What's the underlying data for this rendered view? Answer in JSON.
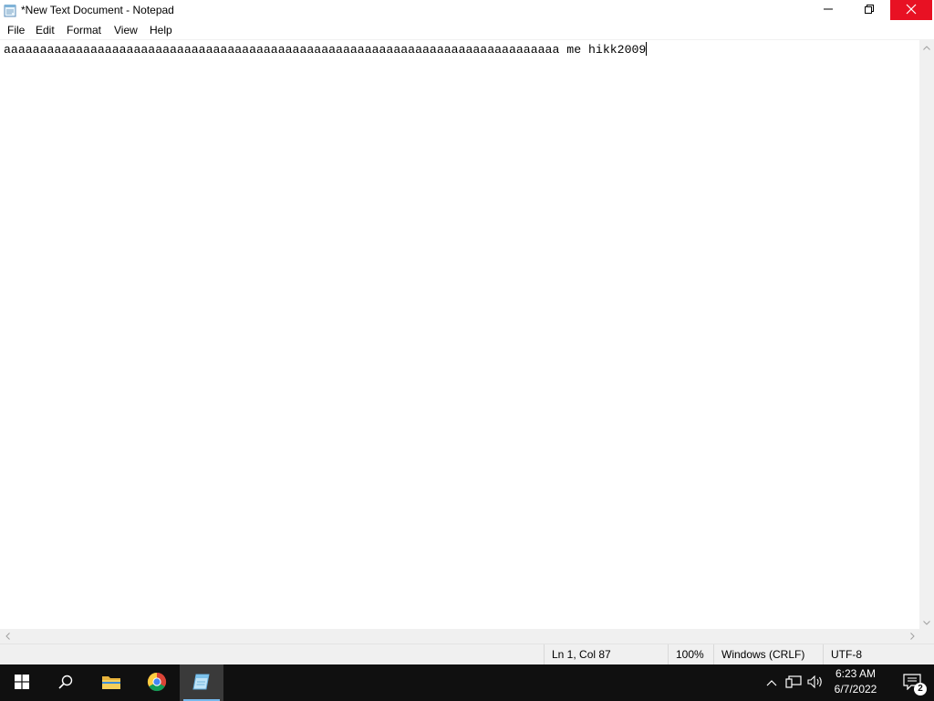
{
  "window": {
    "title": "*New Text Document - Notepad",
    "icons": {
      "app": "notepad-icon",
      "minimize": "minimize-icon",
      "maximize": "restore-icon",
      "close": "close-icon"
    },
    "close_hover_color": "#e81123"
  },
  "menu": {
    "items": [
      "File",
      "Edit",
      "Format",
      "View",
      "Help"
    ]
  },
  "editor": {
    "content": "aaaaaaaaaaaaaaaaaaaaaaaaaaaaaaaaaaaaaaaaaaaaaaaaaaaaaaaaaaaaaaaaaaaaaaaaaaaaa me hikk2009"
  },
  "status": {
    "position": "Ln 1, Col 87",
    "zoom": "100%",
    "line_ending": "Windows (CRLF)",
    "encoding": "UTF-8"
  },
  "taskbar": {
    "apps": [
      "windows-start-icon",
      "search-icon",
      "file-explorer-icon",
      "chrome-icon",
      "notepad-icon"
    ],
    "active_app": "notepad",
    "accent": "#76b9ed",
    "tray_icons": [
      "chevron-up-icon",
      "network-icon",
      "volume-icon"
    ],
    "clock": {
      "time": "6:23 AM",
      "date": "6/7/2022"
    },
    "notification_count": "2"
  }
}
